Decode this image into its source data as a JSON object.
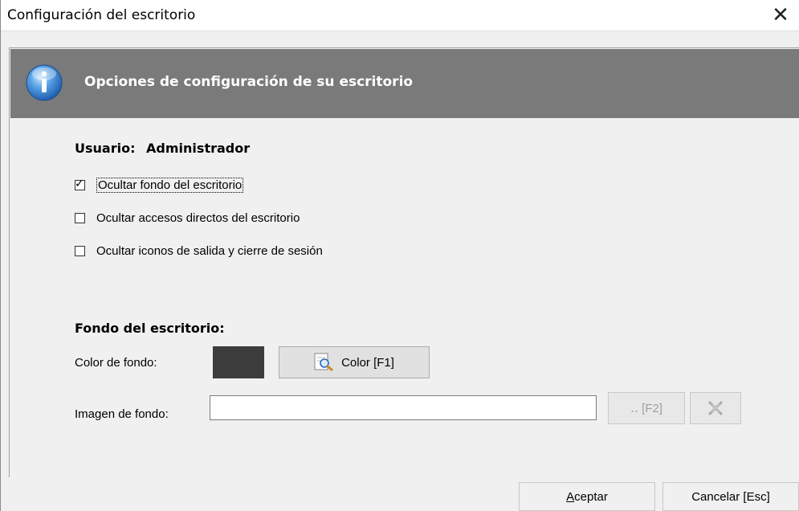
{
  "window": {
    "title": "Configuración del escritorio",
    "close_glyph": "✕"
  },
  "header": {
    "text": "Opciones de configuración de su escritorio",
    "icon": "info-icon",
    "background_color": "#7a7a7a"
  },
  "user": {
    "label": "Usuario:",
    "name": "Administrador"
  },
  "options": [
    {
      "label": "Ocultar fondo del escritorio",
      "checked": true
    },
    {
      "label": "Ocultar accesos directos del escritorio",
      "checked": false
    },
    {
      "label": "Ocultar iconos de salida y cierre de sesión",
      "checked": false
    }
  ],
  "background": {
    "section_title": "Fondo del escritorio:",
    "color_label": "Color de fondo:",
    "color_value": "#3c3c3c",
    "color_button": "Color  [F1]",
    "image_label": "Imagen de fondo:",
    "image_value": "",
    "browse_button": "‥ [F2]",
    "clear_button_icon": "clear-icon"
  },
  "footer": {
    "ok_button": "Aceptar",
    "ok_mnemonic": "A",
    "ok_rest": "ceptar",
    "cancel_button": "Cancelar [Esc]"
  }
}
